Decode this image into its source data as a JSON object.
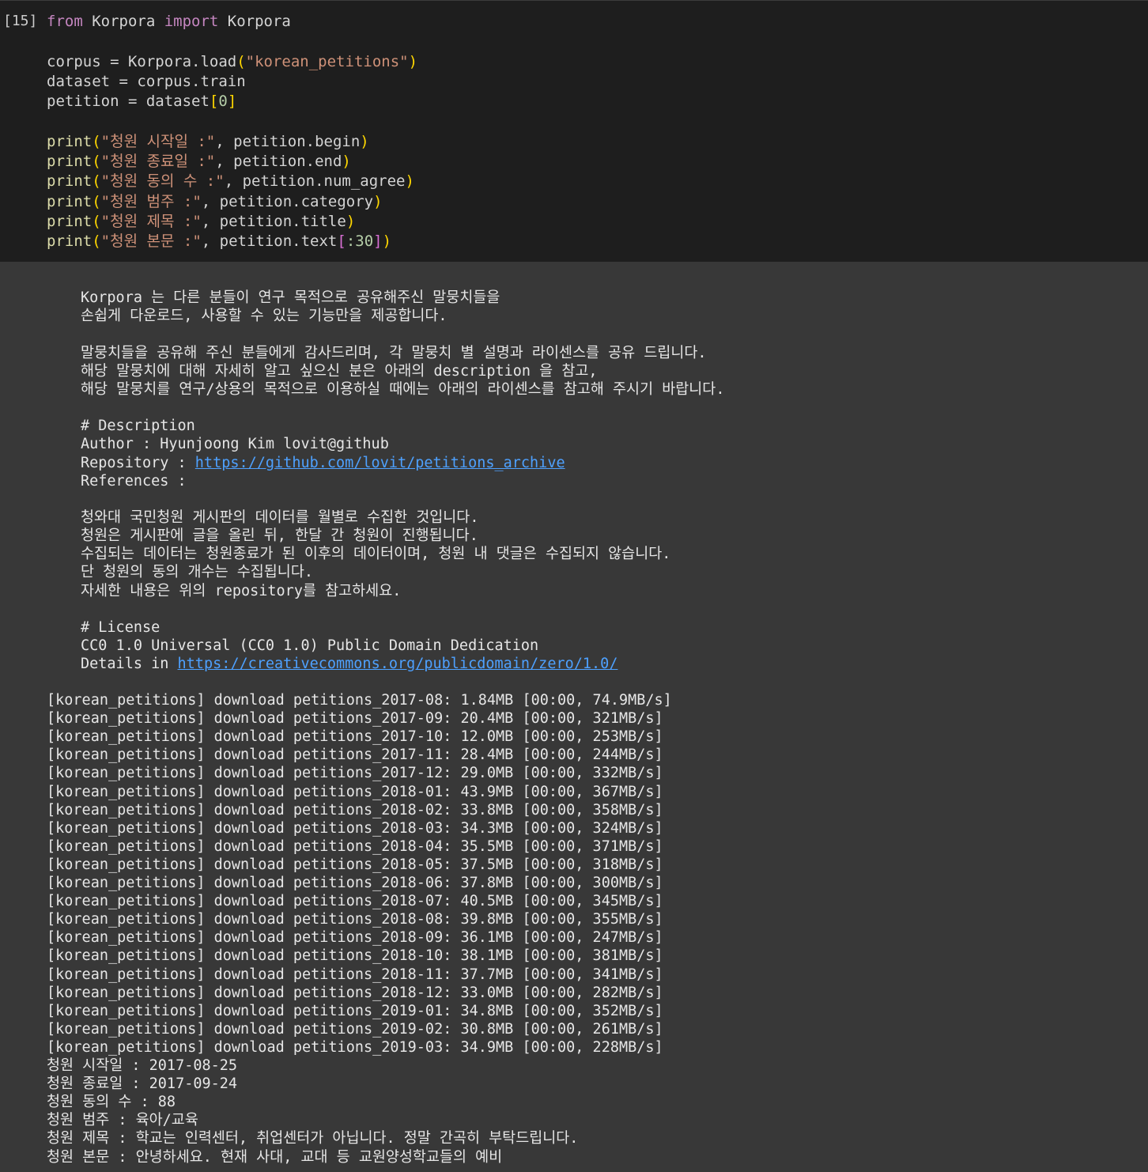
{
  "cell": {
    "execution_count": "[15]",
    "code_lines": [
      [
        {
          "t": "from",
          "c": "kw"
        },
        {
          "t": " Korpora ",
          "c": "plain"
        },
        {
          "t": "import",
          "c": "kw"
        },
        {
          "t": " Korpora",
          "c": "plain"
        }
      ],
      [],
      [
        {
          "t": "corpus = Korpora.load",
          "c": "plain"
        },
        {
          "t": "(",
          "c": "br"
        },
        {
          "t": "\"korean_petitions\"",
          "c": "str"
        },
        {
          "t": ")",
          "c": "br"
        }
      ],
      [
        {
          "t": "dataset = corpus.train",
          "c": "plain"
        }
      ],
      [
        {
          "t": "petition = dataset",
          "c": "plain"
        },
        {
          "t": "[",
          "c": "br"
        },
        {
          "t": "0",
          "c": "num"
        },
        {
          "t": "]",
          "c": "br"
        }
      ],
      [],
      [
        {
          "t": "print",
          "c": "fn"
        },
        {
          "t": "(",
          "c": "br"
        },
        {
          "t": "\"청원 시작일 :\"",
          "c": "str"
        },
        {
          "t": ", petition.begin",
          "c": "plain"
        },
        {
          "t": ")",
          "c": "br"
        }
      ],
      [
        {
          "t": "print",
          "c": "fn"
        },
        {
          "t": "(",
          "c": "br"
        },
        {
          "t": "\"청원 종료일 :\"",
          "c": "str"
        },
        {
          "t": ", petition.end",
          "c": "plain"
        },
        {
          "t": ")",
          "c": "br"
        }
      ],
      [
        {
          "t": "print",
          "c": "fn"
        },
        {
          "t": "(",
          "c": "br"
        },
        {
          "t": "\"청원 동의 수 :\"",
          "c": "str"
        },
        {
          "t": ", petition.num_agree",
          "c": "plain"
        },
        {
          "t": ")",
          "c": "br"
        }
      ],
      [
        {
          "t": "print",
          "c": "fn"
        },
        {
          "t": "(",
          "c": "br"
        },
        {
          "t": "\"청원 범주 :\"",
          "c": "str"
        },
        {
          "t": ", petition.category",
          "c": "plain"
        },
        {
          "t": ")",
          "c": "br"
        }
      ],
      [
        {
          "t": "print",
          "c": "fn"
        },
        {
          "t": "(",
          "c": "br"
        },
        {
          "t": "\"청원 제목 :\"",
          "c": "str"
        },
        {
          "t": ", petition.title",
          "c": "plain"
        },
        {
          "t": ")",
          "c": "br"
        }
      ],
      [
        {
          "t": "print",
          "c": "fn"
        },
        {
          "t": "(",
          "c": "br"
        },
        {
          "t": "\"청원 본문 :\"",
          "c": "str"
        },
        {
          "t": ", petition.text",
          "c": "plain"
        },
        {
          "t": "[",
          "c": "br2"
        },
        {
          "t": ":30",
          "c": "num"
        },
        {
          "t": "]",
          "c": "br2"
        },
        {
          "t": ")",
          "c": "br"
        }
      ]
    ]
  },
  "output": {
    "intro": [
      "Korpora 는 다른 분들이 연구 목적으로 공유해주신 말뭉치들을",
      "손쉽게 다운로드, 사용할 수 있는 기능만을 제공합니다.",
      "",
      "말뭉치들을 공유해 주신 분들에게 감사드리며, 각 말뭉치 별 설명과 라이센스를 공유 드립니다.",
      "해당 말뭉치에 대해 자세히 알고 싶으신 분은 아래의 description 을 참고,",
      "해당 말뭉치를 연구/상용의 목적으로 이용하실 때에는 아래의 라이센스를 참고해 주시기 바랍니다."
    ],
    "description": {
      "heading": "# Description",
      "author": "Author : Hyunjoong Kim lovit@github",
      "repository_label": "Repository : ",
      "repository_url": "https://github.com/lovit/petitions_archive",
      "references": "References :"
    },
    "notes": [
      "청와대 국민청원 게시판의 데이터를 월별로 수집한 것입니다.",
      "청원은 게시판에 글을 올린 뒤, 한달 간 청원이 진행됩니다.",
      "수집되는 데이터는 청원종료가 된 이후의 데이터이며, 청원 내 댓글은 수집되지 않습니다.",
      "단 청원의 동의 개수는 수집됩니다.",
      "자세한 내용은 위의 repository를 참고하세요."
    ],
    "license": {
      "heading": "# License",
      "name": "CC0 1.0 Universal (CC0 1.0) Public Domain Dedication",
      "details_label": "Details in ",
      "details_url": "https://creativecommons.org/publicdomain/zero/1.0/"
    },
    "downloads": [
      "[korean_petitions] download petitions_2017-08: 1.84MB [00:00, 74.9MB/s]",
      "[korean_petitions] download petitions_2017-09: 20.4MB [00:00, 321MB/s]",
      "[korean_petitions] download petitions_2017-10: 12.0MB [00:00, 253MB/s]",
      "[korean_petitions] download petitions_2017-11: 28.4MB [00:00, 244MB/s]",
      "[korean_petitions] download petitions_2017-12: 29.0MB [00:00, 332MB/s]",
      "[korean_petitions] download petitions_2018-01: 43.9MB [00:00, 367MB/s]",
      "[korean_petitions] download petitions_2018-02: 33.8MB [00:00, 358MB/s]",
      "[korean_petitions] download petitions_2018-03: 34.3MB [00:00, 324MB/s]",
      "[korean_petitions] download petitions_2018-04: 35.5MB [00:00, 371MB/s]",
      "[korean_petitions] download petitions_2018-05: 37.5MB [00:00, 318MB/s]",
      "[korean_petitions] download petitions_2018-06: 37.8MB [00:00, 300MB/s]",
      "[korean_petitions] download petitions_2018-07: 40.5MB [00:00, 345MB/s]",
      "[korean_petitions] download petitions_2018-08: 39.8MB [00:00, 355MB/s]",
      "[korean_petitions] download petitions_2018-09: 36.1MB [00:00, 247MB/s]",
      "[korean_petitions] download petitions_2018-10: 38.1MB [00:00, 381MB/s]",
      "[korean_petitions] download petitions_2018-11: 37.7MB [00:00, 341MB/s]",
      "[korean_petitions] download petitions_2018-12: 33.0MB [00:00, 282MB/s]",
      "[korean_petitions] download petitions_2019-01: 34.8MB [00:00, 352MB/s]",
      "[korean_petitions] download petitions_2019-02: 30.8MB [00:00, 261MB/s]",
      "[korean_petitions] download petitions_2019-03: 34.9MB [00:00, 228MB/s]"
    ],
    "results": [
      "청원 시작일 : 2017-08-25",
      "청원 종료일 : 2017-09-24",
      "청원 동의 수 : 88",
      "청원 범주 : 육아/교육",
      "청원 제목 : 학교는 인력센터, 취업센터가 아닙니다. 정말 간곡히 부탁드립니다.",
      "청원 본문 : 안녕하세요. 현재 사대, 교대 등 교원양성학교들의 예비"
    ]
  }
}
